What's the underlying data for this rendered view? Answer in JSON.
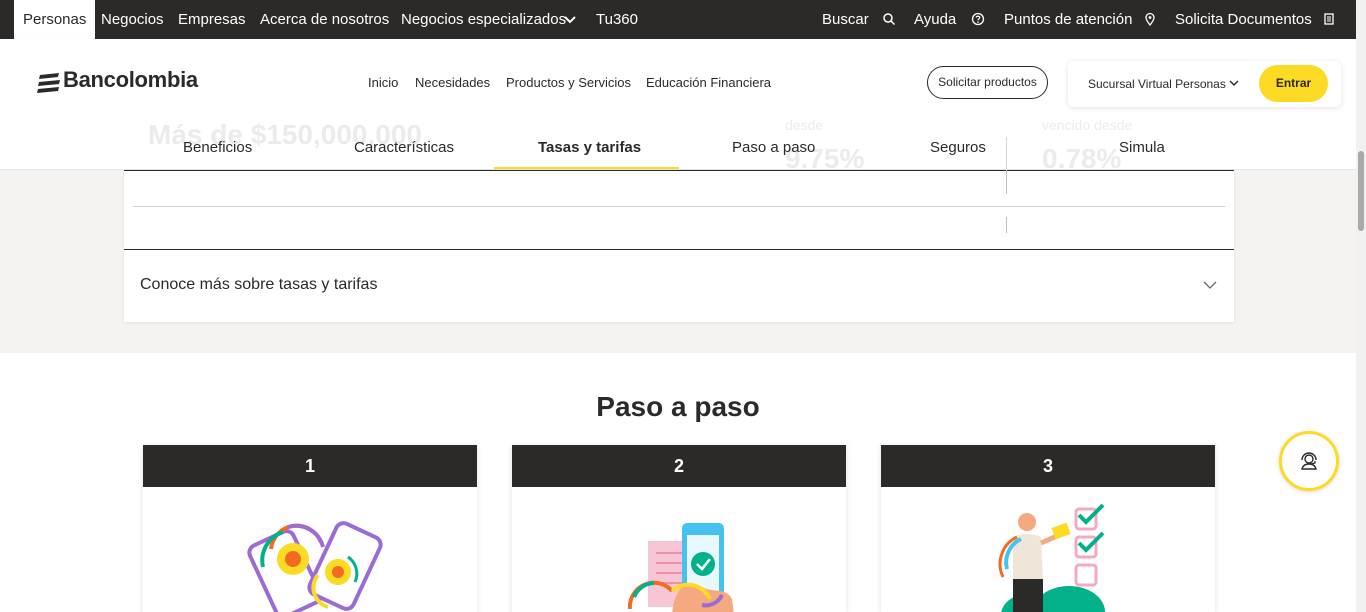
{
  "topbar": {
    "left_items": [
      "Personas",
      "Negocios",
      "Empresas",
      "Acerca de nosotros",
      "Negocios especializados",
      "Tu360"
    ],
    "right_items": [
      "Buscar",
      "Ayuda",
      "Puntos de atención",
      "Solicita Documentos"
    ],
    "icons": [
      "search-icon",
      "help-icon",
      "location-pin-icon",
      "document-icon"
    ]
  },
  "header": {
    "brand": "Bancolombia",
    "nav": [
      "Inicio",
      "Necesidades",
      "Productos y Servicios",
      "Educación Financiera"
    ],
    "solicitar_label": "Solicitar productos",
    "sucursal_label": "Sucursal Virtual Personas",
    "entrar_label": "Entrar"
  },
  "tabs": {
    "items": [
      "Beneficios",
      "Características",
      "Tasas y tarifas",
      "Paso a paso",
      "Seguros",
      "Simula"
    ],
    "active": "Tasas y tarifas",
    "behind": {
      "amount": "Más de $150,000,000",
      "label_left": "desde",
      "rate_left": "9.75%",
      "label_right": "vencido desde",
      "rate_right": "0.78%"
    }
  },
  "rates": {
    "accordion_label": "Conoce más sobre tasas y tarifas"
  },
  "steps": {
    "title": "Paso a paso",
    "items": [
      {
        "number": "1"
      },
      {
        "number": "2"
      },
      {
        "number": "3"
      }
    ]
  },
  "colors": {
    "dark": "#2c2a29",
    "accent_yellow": "#fdda24",
    "light_bg": "#f4f3f2"
  }
}
